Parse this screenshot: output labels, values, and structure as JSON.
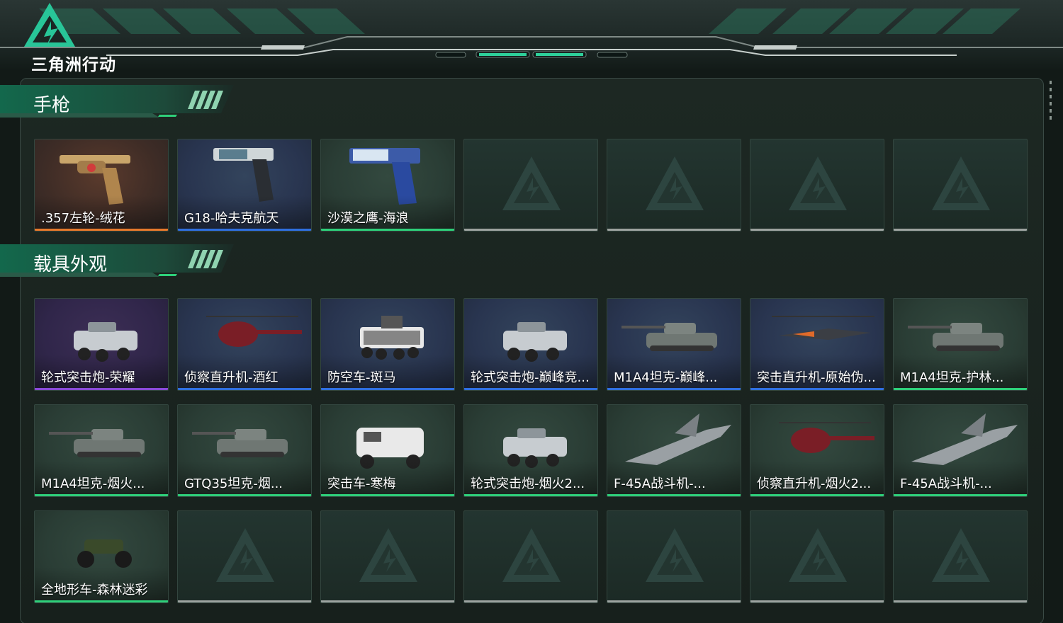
{
  "brand": {
    "logo_text": "三角洲行动"
  },
  "colors": {
    "orange": "#e87a2c",
    "blue": "#2f6fe0",
    "purple": "#8a4ad8",
    "green": "#2ed07a",
    "empty": "#9da3a0"
  },
  "sections": [
    {
      "title": "手枪",
      "items": [
        {
          "label": ".357左轮-绒花",
          "rarity": "orange",
          "icon": "revolver-icon"
        },
        {
          "label": "G18-哈夫克航天",
          "rarity": "blue",
          "icon": "pistol-icon"
        },
        {
          "label": "沙漠之鹰-海浪",
          "rarity": "green",
          "icon": "desert-eagle-icon"
        },
        {
          "label": "",
          "rarity": "empty"
        },
        {
          "label": "",
          "rarity": "empty"
        },
        {
          "label": "",
          "rarity": "empty"
        },
        {
          "label": "",
          "rarity": "empty"
        }
      ]
    },
    {
      "title": "载具外观",
      "items": [
        {
          "label": "轮式突击炮-荣耀",
          "rarity": "purple",
          "icon": "armored-car-icon"
        },
        {
          "label": "侦察直升机-酒红",
          "rarity": "blue",
          "icon": "helicopter-icon"
        },
        {
          "label": "防空车-斑马",
          "rarity": "blue",
          "icon": "aa-vehicle-icon"
        },
        {
          "label": "轮式突击炮-巅峰竞...",
          "rarity": "blue",
          "icon": "armored-car-icon"
        },
        {
          "label": "M1A4坦克-巅峰...",
          "rarity": "blue",
          "icon": "tank-icon"
        },
        {
          "label": "突击直升机-原始伪...",
          "rarity": "blue",
          "icon": "attack-helicopter-icon"
        },
        {
          "label": "M1A4坦克-护林...",
          "rarity": "green",
          "icon": "tank-icon"
        },
        {
          "label": "M1A4坦克-烟火...",
          "rarity": "green",
          "icon": "tank-icon"
        },
        {
          "label": "GTQ35坦克-烟...",
          "rarity": "green",
          "icon": "tank-icon"
        },
        {
          "label": "突击车-寒梅",
          "rarity": "green",
          "icon": "assault-vehicle-icon"
        },
        {
          "label": "轮式突击炮-烟火2...",
          "rarity": "green",
          "icon": "armored-car-icon"
        },
        {
          "label": "F-45A战斗机-...",
          "rarity": "green",
          "icon": "fighter-jet-icon"
        },
        {
          "label": "侦察直升机-烟火2...",
          "rarity": "green",
          "icon": "helicopter-icon"
        },
        {
          "label": "F-45A战斗机-...",
          "rarity": "green",
          "icon": "fighter-jet-icon"
        },
        {
          "label": "全地形车-森林迷彩",
          "rarity": "green",
          "icon": "atv-icon"
        },
        {
          "label": "",
          "rarity": "empty"
        },
        {
          "label": "",
          "rarity": "empty"
        },
        {
          "label": "",
          "rarity": "empty"
        },
        {
          "label": "",
          "rarity": "empty"
        },
        {
          "label": "",
          "rarity": "empty"
        },
        {
          "label": "",
          "rarity": "empty"
        }
      ]
    }
  ]
}
